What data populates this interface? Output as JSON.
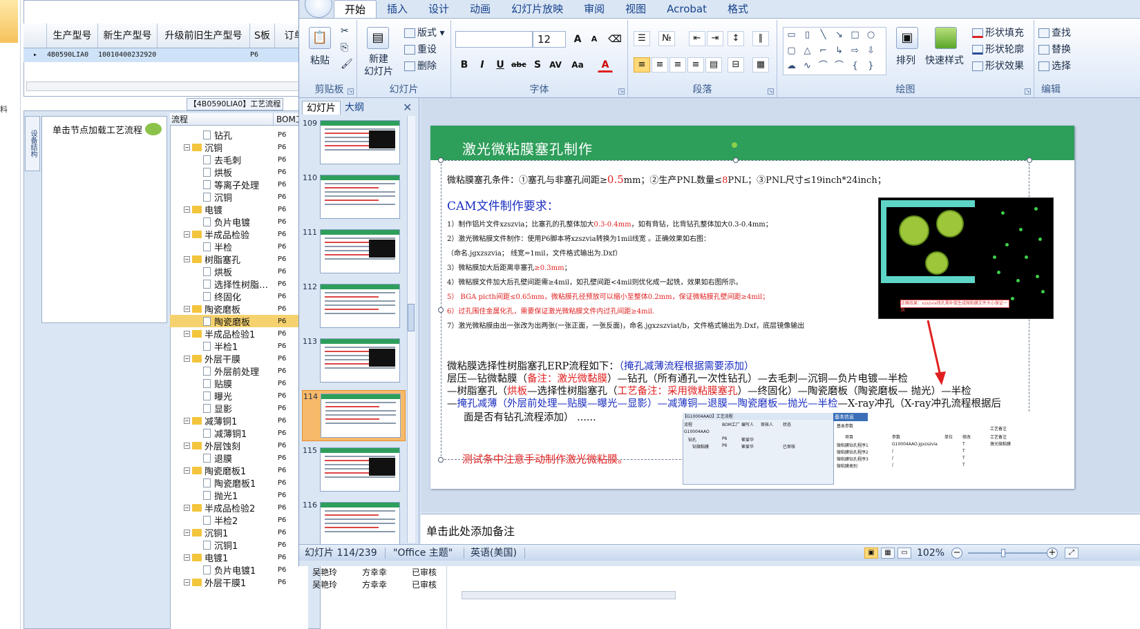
{
  "erp": {
    "side_char": "料",
    "grid_headers": [
      "生产型号",
      "新生产型号",
      "升级前旧生产型号",
      "S板",
      "订单"
    ],
    "grid_row": [
      "4B0590LIA0",
      "10010400232920",
      "",
      "P6"
    ],
    "flow_title": "【4B0590LIA0】工艺流程",
    "vertical_tab": "设备结构",
    "node_tip": "单击节点加载工艺流程",
    "tree_headers": [
      "流程",
      "BOM工"
    ],
    "tree": [
      {
        "level": 2,
        "type": "doc",
        "label": "钻孔",
        "bom": "P6"
      },
      {
        "level": 1,
        "type": "folder",
        "label": "沉铜",
        "bom": "P6"
      },
      {
        "level": 2,
        "type": "doc",
        "label": "去毛刺",
        "bom": "P6"
      },
      {
        "level": 2,
        "type": "doc",
        "label": "烘板",
        "bom": "P6"
      },
      {
        "level": 2,
        "type": "doc",
        "label": "等离子处理",
        "bom": "P6"
      },
      {
        "level": 2,
        "type": "doc",
        "label": "沉铜",
        "bom": "P6"
      },
      {
        "level": 1,
        "type": "folder",
        "label": "电镀",
        "bom": "P6"
      },
      {
        "level": 2,
        "type": "doc",
        "label": "负片电镀",
        "bom": "P6"
      },
      {
        "level": 1,
        "type": "folder",
        "label": "半成品检验",
        "bom": "P6"
      },
      {
        "level": 2,
        "type": "doc",
        "label": "半检",
        "bom": "P6"
      },
      {
        "level": 1,
        "type": "folder",
        "label": "树脂塞孔",
        "bom": "P6"
      },
      {
        "level": 2,
        "type": "doc",
        "label": "烘板",
        "bom": "P6"
      },
      {
        "level": 2,
        "type": "doc",
        "label": "选择性树脂…",
        "bom": "P6"
      },
      {
        "level": 2,
        "type": "doc",
        "label": "终固化",
        "bom": "P6"
      },
      {
        "level": 1,
        "type": "folder",
        "label": "陶瓷磨板",
        "bom": "P6"
      },
      {
        "level": 2,
        "type": "doc",
        "label": "陶瓷磨板",
        "bom": "P6",
        "selected": true
      },
      {
        "level": 1,
        "type": "folder",
        "label": "半成品检验1",
        "bom": "P6"
      },
      {
        "level": 2,
        "type": "doc",
        "label": "半检1",
        "bom": "P6"
      },
      {
        "level": 1,
        "type": "folder",
        "label": "外层干膜",
        "bom": "P6"
      },
      {
        "level": 2,
        "type": "doc",
        "label": "外层前处理",
        "bom": "P6"
      },
      {
        "level": 2,
        "type": "doc",
        "label": "贴膜",
        "bom": "P6"
      },
      {
        "level": 2,
        "type": "doc",
        "label": "曝光",
        "bom": "P6"
      },
      {
        "level": 2,
        "type": "doc",
        "label": "显影",
        "bom": "P6"
      },
      {
        "level": 1,
        "type": "folder",
        "label": "减薄铜1",
        "bom": "P6"
      },
      {
        "level": 2,
        "type": "doc",
        "label": "减薄铜1",
        "bom": "P6"
      },
      {
        "level": 1,
        "type": "folder",
        "label": "外层蚀刻",
        "bom": "P6"
      },
      {
        "level": 2,
        "type": "doc",
        "label": "退膜",
        "bom": "P6"
      },
      {
        "level": 1,
        "type": "folder",
        "label": "陶瓷磨板1",
        "bom": "P6"
      },
      {
        "level": 2,
        "type": "doc",
        "label": "陶瓷磨板1",
        "bom": "P6"
      },
      {
        "level": 2,
        "type": "doc",
        "label": "抛光1",
        "bom": "P6"
      },
      {
        "level": 1,
        "type": "folder",
        "label": "半成品检验2",
        "bom": "P6"
      },
      {
        "level": 2,
        "type": "doc",
        "label": "半检2",
        "bom": "P6"
      },
      {
        "level": 1,
        "type": "folder",
        "label": "沉铜1",
        "bom": "P6"
      },
      {
        "level": 2,
        "type": "doc",
        "label": "沉铜1",
        "bom": "P6"
      },
      {
        "level": 1,
        "type": "folder",
        "label": "电镀1",
        "bom": "P6"
      },
      {
        "level": 2,
        "type": "doc",
        "label": "负片电镀1",
        "bom": "P6"
      },
      {
        "level": 1,
        "type": "folder",
        "label": "外层干膜1",
        "bom": "P6"
      }
    ],
    "bottom_rows": [
      [
        "吴艳玲",
        "方幸幸",
        "已审核"
      ],
      [
        "吴艳玲",
        "方幸幸",
        "已审核"
      ]
    ]
  },
  "ppt": {
    "tabs": [
      "开始",
      "插入",
      "设计",
      "动画",
      "幻灯片放映",
      "审阅",
      "视图",
      "Acrobat",
      "格式"
    ],
    "active_tab": "开始",
    "clipboard": {
      "paste": "粘贴",
      "label": "剪贴板"
    },
    "slides_group": {
      "new_slide": "新建\n幻灯片",
      "layout": "版式",
      "reset": "重设",
      "delete": "删除",
      "label": "幻灯片"
    },
    "font_group": {
      "font_name": "",
      "font_size": "12",
      "label": "字体"
    },
    "paragraph_group": {
      "label": "段落"
    },
    "drawing_group": {
      "arrange": "排列",
      "quick_styles": "快速样式",
      "fill": "形状填充",
      "outline": "形状轮廓",
      "effects": "形状效果",
      "label": "绘图"
    },
    "editing_group": {
      "find": "查找",
      "replace": "替换",
      "select": "选择",
      "label": "编辑"
    },
    "pane_tabs": [
      "幻灯片",
      "大纲"
    ],
    "thumbnails": [
      109,
      110,
      111,
      112,
      113,
      114,
      115,
      116
    ],
    "selected_thumbnail": 114,
    "slide": {
      "title": "激光微粘膜塞孔制作",
      "condition_pre": "微粘膜塞孔条件：①塞孔与非塞孔间距≥",
      "condition_red1": "0.5",
      "condition_mid": "mm；②生产PNL数量≤",
      "condition_red2": "8",
      "condition_post": "PNL；③PNL尺寸≤19inch*24inch；",
      "cam_header": "CAM文件制作要求：",
      "items": [
        {
          "text": "1）制作铝片文件xzszvia；比塞孔的孔整体加大",
          "red": "0.3-0.4mm",
          "tail": "，如有背钻，比背钻孔整体加大0.3-0.4mm；"
        },
        {
          "text": "2）激光微粘膜文件制作：使用P6脚本将xzszvia转换为1mil线宽  。正确效果如右图：",
          "red": "",
          "tail": ""
        },
        {
          "text": "（命名.jgxzszvia；  线宽=1mil，文件格式输出为.Dxf）",
          "red": "",
          "tail": ""
        },
        {
          "text": "3）微粘膜加大后距离非塞孔",
          "red": "≥0.3mm",
          "tail": "；"
        },
        {
          "text": "4）微粘膜文件加大后孔壁间距需≥4mil，如孔壁间距<4mil则优化成一起铣，效果如右图所示。",
          "red": "",
          "tail": ""
        },
        {
          "text": "",
          "red": "5）  BGA  picth间距≤0.65mm，微粘膜孔径预放可以缩小至整体0.2mm，保证微粘膜孔壁间距≥4mil；",
          "tail": ""
        },
        {
          "text": "",
          "red": "6）过孔围住金属化孔，需要保证激光微粘膜文件内过孔间距≥4mil.",
          "tail": ""
        },
        {
          "text": "7）激光微粘膜由出一张改为出两张(一张正面，一张反面)，命名.jgxzszviat/b，文件格式输出为.Dxf，底层镜像输出",
          "red": "",
          "tail": ""
        }
      ],
      "flow_lines": [
        [
          {
            "t": "微粘膜选择性树脂塞孔ERP流程如下：",
            "c": ""
          },
          {
            "t": "（掩孔减薄流程根据需要添加）",
            "c": "blue"
          }
        ],
        [
          {
            "t": "层压—钻微黏膜（",
            "c": ""
          },
          {
            "t": "备注：激光微黏膜",
            "c": "red"
          },
          {
            "t": "）—钻孔（所有通孔一次性钻孔）—去毛刺—沉铜—负片电镀—半检",
            "c": ""
          }
        ],
        [
          {
            "t": "—树脂塞孔（",
            "c": ""
          },
          {
            "t": "烘板",
            "c": "red"
          },
          {
            "t": "—选择性树脂塞孔（",
            "c": ""
          },
          {
            "t": "工艺备注：采用微粘膜塞孔",
            "c": "red"
          },
          {
            "t": "）—终固化）—陶瓷磨板（陶瓷磨板— 抛光）—半检",
            "c": ""
          }
        ],
        [
          {
            "t": "—",
            "c": ""
          },
          {
            "t": "掩孔减薄（外层前处理—贴膜—曝光—显影）—减薄铜—退膜—陶瓷磨板—抛光—半检",
            "c": "blue"
          },
          {
            "t": "—X-ray冲孔（X-ray冲孔流程根据后",
            "c": ""
          }
        ],
        [
          {
            "t": "面是否有钻孔流程添加）  ......",
            "c": ""
          }
        ]
      ],
      "pcb_note": "正确效果：xzszvia铣孔需补偿生成微粘膜文件大小保证一致",
      "test_note": "测试条中注意手动制作激光微粘膜。",
      "erp_shot": {
        "tree_title": "【G10004AAO】工艺流程",
        "tree_cols": [
          "流程",
          "BOM工厂",
          "编写人",
          "审核人",
          "状态"
        ],
        "tree_rows": [
          [
            "G10004AAO",
            "",
            "",
            "",
            ""
          ],
          [
            "钻孔",
            "P6",
            "崔爱华",
            "",
            ""
          ],
          [
            "钻微黏膜",
            "P6",
            "崔爱华",
            "",
            "已审核"
          ]
        ],
        "panel_tab": "基本信息",
        "panel_sub": "基本参数",
        "panel_side": "工艺备注",
        "cols": [
          "项目",
          "参数",
          "单位",
          "修改"
        ],
        "rows": [
          [
            "微粘膜钻孔程序1",
            "G10004AAO.jgxzszvia",
            "",
            "T"
          ],
          [
            "微粘膜钻孔程序2",
            "/",
            "",
            "T"
          ],
          [
            "微粘膜钻孔程序3",
            "/",
            "",
            "T"
          ],
          [
            "微粘膜类别",
            "/",
            "",
            "T"
          ]
        ],
        "side_note_label": "工艺备注",
        "side_note": "激光微黏膜"
      }
    },
    "notes_placeholder": "单击此处添加备注",
    "status": {
      "slide_counter": "幻灯片 114/239",
      "theme": "\"Office 主题\"",
      "language": "英语(美国)",
      "zoom": "102%"
    }
  }
}
